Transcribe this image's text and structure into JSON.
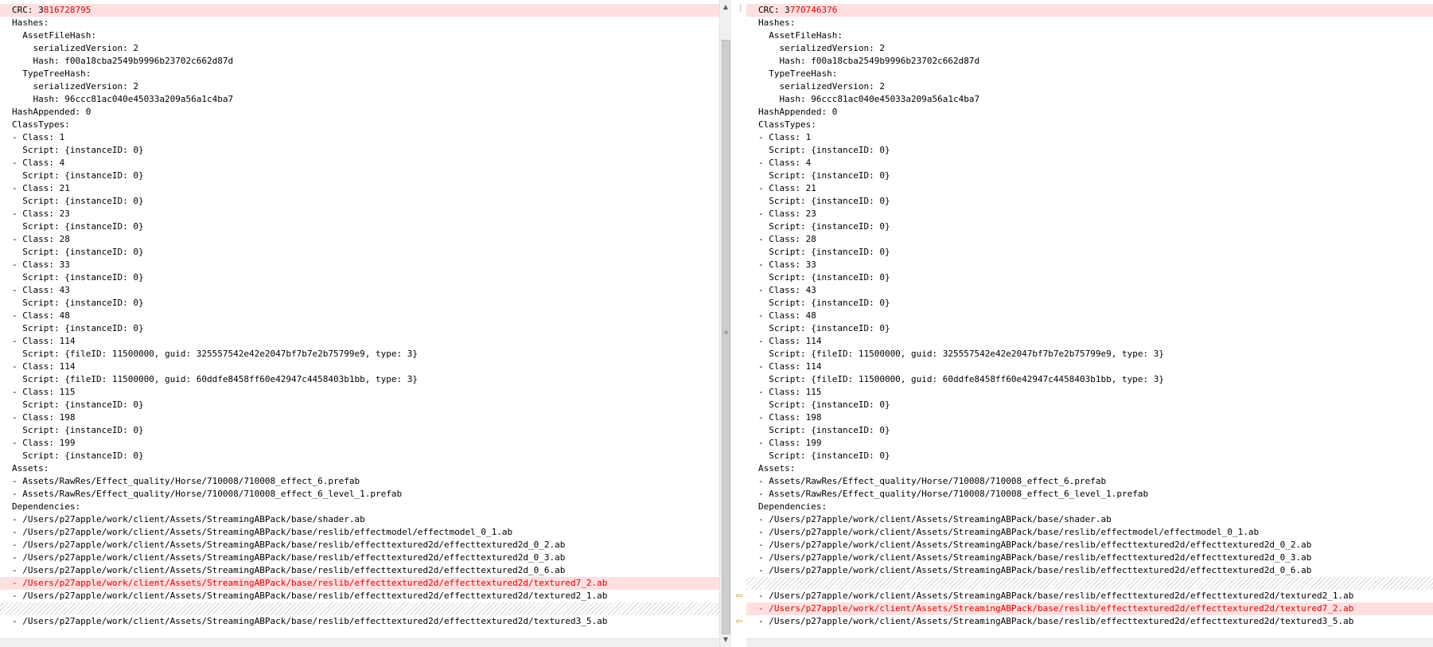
{
  "left": {
    "crc": {
      "prefix": "CRC: 3",
      "value": "816728795"
    },
    "lines": [
      {
        "text": "Hashes:"
      },
      {
        "text": "  AssetFileHash:"
      },
      {
        "text": "    serializedVersion: 2"
      },
      {
        "text": "    Hash: f00a18cba2549b9996b23702c662d87d"
      },
      {
        "text": "  TypeTreeHash:"
      },
      {
        "text": "    serializedVersion: 2"
      },
      {
        "text": "    Hash: 96ccc81ac040e45033a209a56a1c4ba7"
      },
      {
        "text": "HashAppended: 0"
      },
      {
        "text": "ClassTypes:"
      },
      {
        "text": "- Class: 1"
      },
      {
        "text": "  Script: {instanceID: 0}"
      },
      {
        "text": "- Class: 4"
      },
      {
        "text": "  Script: {instanceID: 0}"
      },
      {
        "text": "- Class: 21"
      },
      {
        "text": "  Script: {instanceID: 0}"
      },
      {
        "text": "- Class: 23"
      },
      {
        "text": "  Script: {instanceID: 0}"
      },
      {
        "text": "- Class: 28"
      },
      {
        "text": "  Script: {instanceID: 0}"
      },
      {
        "text": "- Class: 33"
      },
      {
        "text": "  Script: {instanceID: 0}"
      },
      {
        "text": "- Class: 43"
      },
      {
        "text": "  Script: {instanceID: 0}"
      },
      {
        "text": "- Class: 48"
      },
      {
        "text": "  Script: {instanceID: 0}"
      },
      {
        "text": "- Class: 114"
      },
      {
        "text": "  Script: {fileID: 11500000, guid: 325557542e42e2047bf7b7e2b75799e9, type: 3}"
      },
      {
        "text": "- Class: 114"
      },
      {
        "text": "  Script: {fileID: 11500000, guid: 60ddfe8458ff60e42947c4458403b1bb, type: 3}"
      },
      {
        "text": "- Class: 115"
      },
      {
        "text": "  Script: {instanceID: 0}"
      },
      {
        "text": "- Class: 198"
      },
      {
        "text": "  Script: {instanceID: 0}"
      },
      {
        "text": "- Class: 199"
      },
      {
        "text": "  Script: {instanceID: 0}"
      },
      {
        "text": "Assets:"
      },
      {
        "text": "- Assets/RawRes/Effect_quality/Horse/710008/710008_effect_6.prefab"
      },
      {
        "text": "- Assets/RawRes/Effect_quality/Horse/710008/710008_effect_6_level_1.prefab"
      },
      {
        "text": "Dependencies:"
      },
      {
        "text": "- /Users/p27apple/work/client/Assets/StreamingABPack/base/shader.ab"
      },
      {
        "text": "- /Users/p27apple/work/client/Assets/StreamingABPack/base/reslib/effectmodel/effectmodel_0_1.ab"
      },
      {
        "text": "- /Users/p27apple/work/client/Assets/StreamingABPack/base/reslib/effecttextured2d/effecttextured2d_0_2.ab"
      },
      {
        "text": "- /Users/p27apple/work/client/Assets/StreamingABPack/base/reslib/effecttextured2d/effecttextured2d_0_3.ab"
      },
      {
        "text": "- /Users/p27apple/work/client/Assets/StreamingABPack/base/reslib/effecttextured2d/effecttextured2d_0_6.ab"
      },
      {
        "text": "- /Users/p27apple/work/client/Assets/StreamingABPack/base/reslib/effecttextured2d/effecttextured2d/textured7_2.ab",
        "kind": "diff"
      },
      {
        "text": "- /Users/p27apple/work/client/Assets/StreamingABPack/base/reslib/effecttextured2d/effecttextured2d/textured2_1.ab"
      },
      {
        "text": "",
        "kind": "gap"
      },
      {
        "text": "- /Users/p27apple/work/client/Assets/StreamingABPack/base/reslib/effecttextured2d/effecttextured2d/textured3_5.ab"
      }
    ]
  },
  "right": {
    "crc": {
      "prefix": "CRC: 3",
      "value": "770746376"
    },
    "lines": [
      {
        "text": "Hashes:"
      },
      {
        "text": "  AssetFileHash:"
      },
      {
        "text": "    serializedVersion: 2"
      },
      {
        "text": "    Hash: f00a18cba2549b9996b23702c662d87d"
      },
      {
        "text": "  TypeTreeHash:"
      },
      {
        "text": "    serializedVersion: 2"
      },
      {
        "text": "    Hash: 96ccc81ac040e45033a209a56a1c4ba7"
      },
      {
        "text": "HashAppended: 0"
      },
      {
        "text": "ClassTypes:"
      },
      {
        "text": "- Class: 1"
      },
      {
        "text": "  Script: {instanceID: 0}"
      },
      {
        "text": "- Class: 4"
      },
      {
        "text": "  Script: {instanceID: 0}"
      },
      {
        "text": "- Class: 21"
      },
      {
        "text": "  Script: {instanceID: 0}"
      },
      {
        "text": "- Class: 23"
      },
      {
        "text": "  Script: {instanceID: 0}"
      },
      {
        "text": "- Class: 28"
      },
      {
        "text": "  Script: {instanceID: 0}"
      },
      {
        "text": "- Class: 33"
      },
      {
        "text": "  Script: {instanceID: 0}"
      },
      {
        "text": "- Class: 43"
      },
      {
        "text": "  Script: {instanceID: 0}"
      },
      {
        "text": "- Class: 48"
      },
      {
        "text": "  Script: {instanceID: 0}"
      },
      {
        "text": "- Class: 114"
      },
      {
        "text": "  Script: {fileID: 11500000, guid: 325557542e42e2047bf7b7e2b75799e9, type: 3}"
      },
      {
        "text": "- Class: 114"
      },
      {
        "text": "  Script: {fileID: 11500000, guid: 60ddfe8458ff60e42947c4458403b1bb, type: 3}"
      },
      {
        "text": "- Class: 115"
      },
      {
        "text": "  Script: {instanceID: 0}"
      },
      {
        "text": "- Class: 198"
      },
      {
        "text": "  Script: {instanceID: 0}"
      },
      {
        "text": "- Class: 199"
      },
      {
        "text": "  Script: {instanceID: 0}"
      },
      {
        "text": "Assets:"
      },
      {
        "text": "- Assets/RawRes/Effect_quality/Horse/710008/710008_effect_6.prefab"
      },
      {
        "text": "- Assets/RawRes/Effect_quality/Horse/710008/710008_effect_6_level_1.prefab"
      },
      {
        "text": "Dependencies:"
      },
      {
        "text": "- /Users/p27apple/work/client/Assets/StreamingABPack/base/shader.ab"
      },
      {
        "text": "- /Users/p27apple/work/client/Assets/StreamingABPack/base/reslib/effectmodel/effectmodel_0_1.ab"
      },
      {
        "text": "- /Users/p27apple/work/client/Assets/StreamingABPack/base/reslib/effecttextured2d/effecttextured2d_0_2.ab"
      },
      {
        "text": "- /Users/p27apple/work/client/Assets/StreamingABPack/base/reslib/effecttextured2d/effecttextured2d_0_3.ab"
      },
      {
        "text": "- /Users/p27apple/work/client/Assets/StreamingABPack/base/reslib/effecttextured2d/effecttextured2d_0_6.ab"
      },
      {
        "text": "",
        "kind": "gap"
      },
      {
        "text": "- /Users/p27apple/work/client/Assets/StreamingABPack/base/reslib/effecttextured2d/effecttextured2d/textured2_1.ab"
      },
      {
        "text": "- /Users/p27apple/work/client/Assets/StreamingABPack/base/reslib/effecttextured2d/effecttextured2d/textured7_2.ab",
        "kind": "diff"
      },
      {
        "text": "- /Users/p27apple/work/client/Assets/StreamingABPack/base/reslib/effecttextured2d/effecttextured2d/textured3_5.ab"
      }
    ]
  },
  "gutter": {
    "marks": [
      {
        "icon": "copy-left-arrow-icon",
        "glyph": "⇦",
        "line": 45
      },
      {
        "icon": "copy-left-arrow-icon",
        "glyph": "⇦",
        "line": 47
      }
    ]
  },
  "scrollbar": {
    "up": "▲",
    "down": "▼",
    "grip": "≡"
  },
  "colors": {
    "diff_text": "#e00000",
    "diff_bg": "#ffe0e0",
    "marker": "#c8a000"
  }
}
